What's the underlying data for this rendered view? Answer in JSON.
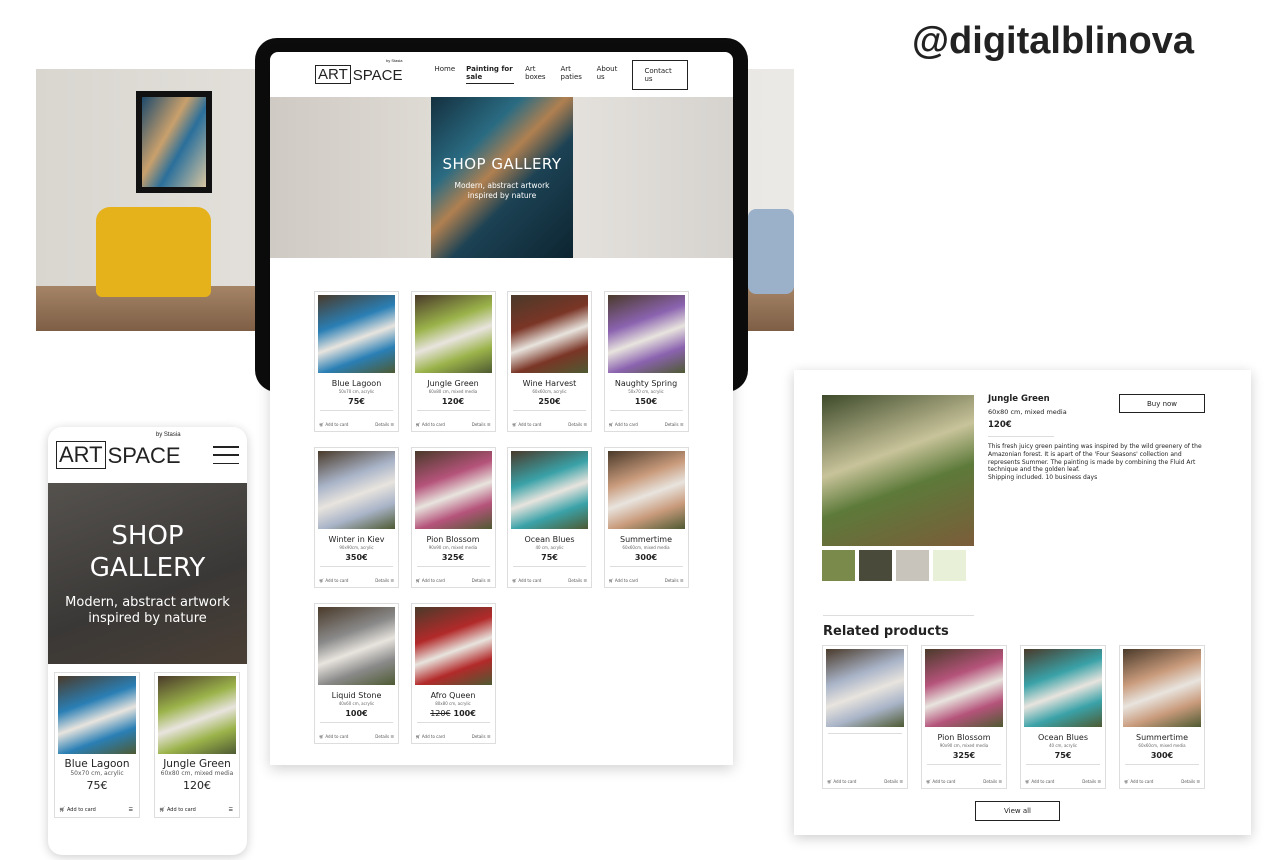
{
  "handle": "@digitalblinova",
  "brand": {
    "box": "ART",
    "word": "SPACE",
    "by": "by Stasia"
  },
  "nav": {
    "items": [
      "Home",
      "Painting for sale",
      "Art boxes",
      "Art paties",
      "About us"
    ],
    "active": "Painting for sale",
    "contact": "Contact us"
  },
  "hero": {
    "title": "SHOP GALLERY",
    "subtitle_line1": "Modern, abstract artwork",
    "subtitle_line2": "inspired by nature"
  },
  "mobile_hero": {
    "title_line1": "SHOP",
    "title_line2": "GALLERY",
    "subtitle_line1": "Modern, abstract artwork",
    "subtitle_line2": "inspired by nature"
  },
  "card_actions": {
    "add": "Add to card",
    "details": "Details"
  },
  "products": [
    {
      "name": "Blue Lagoon",
      "size": "50x70 cm, acrylic",
      "price": "75€",
      "color": "#2a7fb5"
    },
    {
      "name": "Jungle Green",
      "size": "60x80 cm, mixed media",
      "price": "120€",
      "color": "#9bb34a"
    },
    {
      "name": "Wine Harvest",
      "size": "60x60cm, acrylic",
      "price": "250€",
      "color": "#7a3526"
    },
    {
      "name": "Naughty Spring",
      "size": "50x70 cm, acrylic",
      "price": "150€",
      "color": "#8b63b0"
    },
    {
      "name": "Winter in Kiev",
      "size": "90x90cm, acrylic",
      "price": "350€",
      "color": "#a9b4c8"
    },
    {
      "name": "Pion Blossom",
      "size": "90x90 cm, mixed media",
      "price": "325€",
      "color": "#b5537a"
    },
    {
      "name": "Ocean Blues",
      "size": "40 cm, acrylic",
      "price": "75€",
      "color": "#3aa2a8"
    },
    {
      "name": "Summertime",
      "size": "60x60cm, mixed media",
      "price": "300€",
      "color": "#c99b7c"
    },
    {
      "name": "Liquid Stone",
      "size": "40x60 cm, acrylic",
      "price": "100€",
      "color": "#8a8a8a"
    },
    {
      "name": "Afro Queen",
      "size": "80x80 cm, acrylic",
      "price": "100€",
      "old_price": "120€",
      "color": "#b22a2a"
    }
  ],
  "detail": {
    "name": "Jungle Green",
    "size": "60x80 cm, mixed media",
    "price": "120€",
    "buy": "Buy now",
    "description": "This fresh juicy green painting was inspired by the wild greenery of the Amazonian forest. It is apart of the 'Four Seasons' collection and represents Summer. The painting is made by combining the Fluid Art technique and the golden leaf.",
    "shipping": "Shipping included. 10 business days",
    "related_title": "Related products",
    "view_all": "View all"
  },
  "related": [
    {
      "name": "",
      "size": "",
      "price": "",
      "color": "#a9b4c8"
    },
    {
      "name": "Pion Blossom",
      "size": "90x90 cm, mixed media",
      "price": "325€",
      "color": "#b5537a"
    },
    {
      "name": "Ocean Blues",
      "size": "40 cm, acrylic",
      "price": "75€",
      "color": "#3aa2a8"
    },
    {
      "name": "Summertime",
      "size": "60x60cm, mixed media",
      "price": "300€",
      "color": "#c99b7c"
    }
  ]
}
